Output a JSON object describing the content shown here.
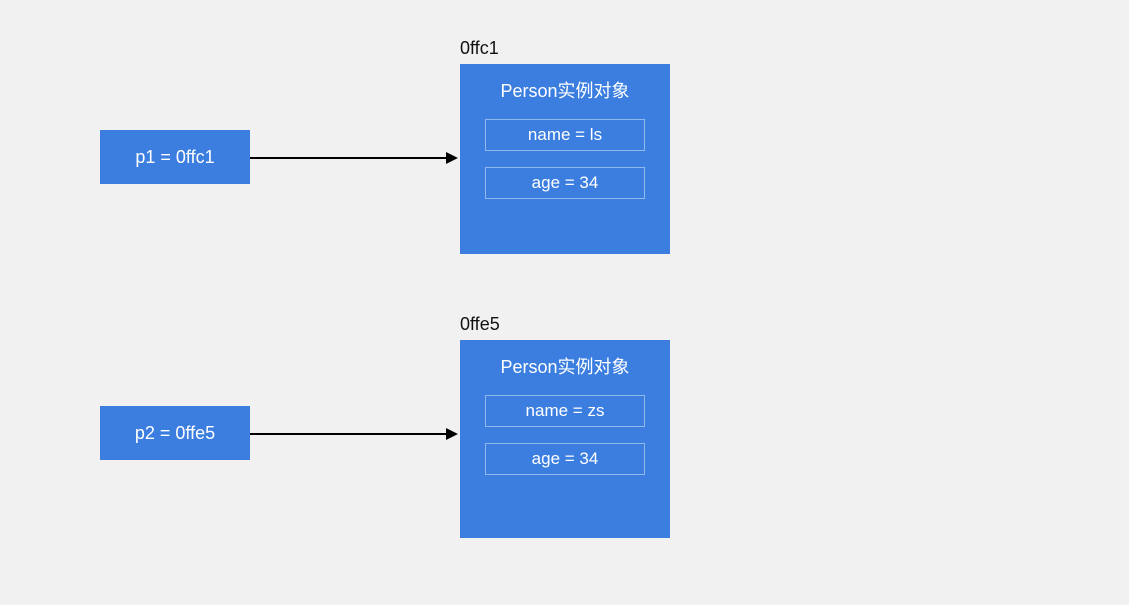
{
  "p1": {
    "var_label": "p1 = 0ffc1",
    "addr_label": "0ffc1",
    "obj_title": "Person实例对象",
    "name_field": "name = ls",
    "age_field": "age = 34"
  },
  "p2": {
    "var_label": "p2 = 0ffe5",
    "addr_label": "0ffe5",
    "obj_title": "Person实例对象",
    "name_field": "name = zs",
    "age_field": "age = 34"
  }
}
